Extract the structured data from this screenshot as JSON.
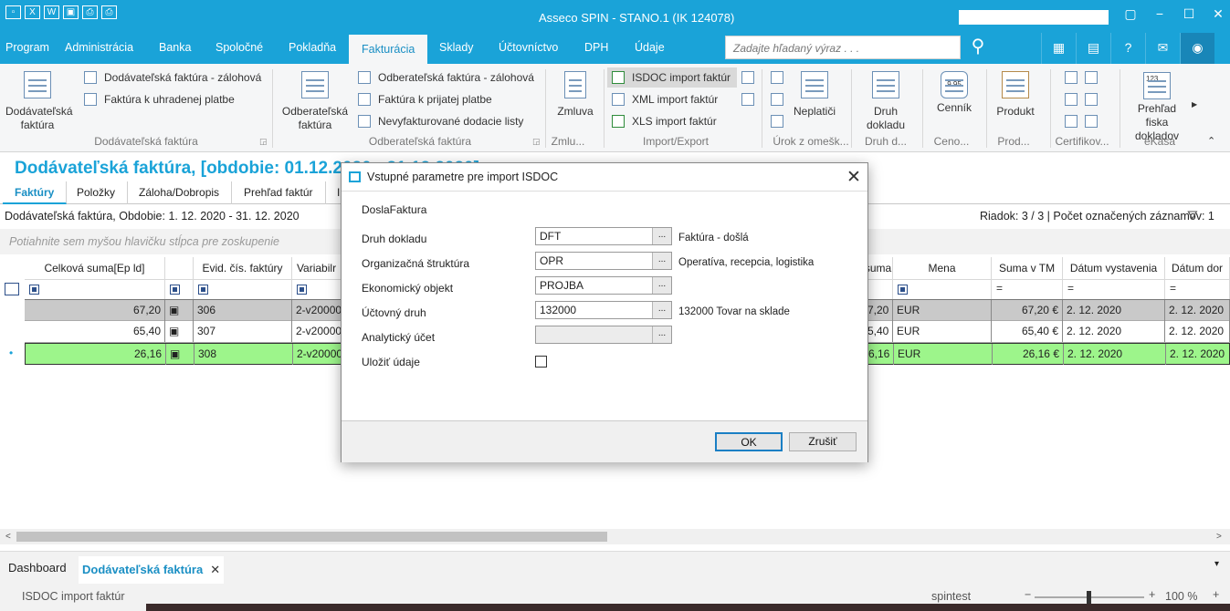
{
  "app": {
    "title": "Asseco SPIN    -    STANO.1 (IK 124078)"
  },
  "menu": {
    "items": [
      "Program",
      "Administrácia",
      "Banka",
      "Spoločné",
      "Pokladňa",
      "Fakturácia",
      "Sklady",
      "Účtovníctvo",
      "DPH",
      "Údaje"
    ],
    "active": "Fakturácia",
    "search_placeholder": "Zadajte hľadaný výraz . . ."
  },
  "ribbon": {
    "dodavatelska": {
      "big_label": "Dodávateľská faktúra",
      "small1": "Dodávateľská faktúra - zálohová",
      "small2": "Faktúra k uhradenej platbe",
      "group": "Dodávateľská faktúra"
    },
    "odberatelska": {
      "big_label": "Odberateľská faktúra",
      "small1": "Odberateľská faktúra - zálohová",
      "small2": "Faktúra k prijatej platbe",
      "small3": "Nevyfakturované dodacie listy",
      "group": "Odberateľská faktúra"
    },
    "zmluva": {
      "label": "Zmluva",
      "group": "Zmlu..."
    },
    "import_export": {
      "isdoc": "ISDOC import faktúr",
      "xml": "XML import faktúr",
      "xls": "XLS import faktúr",
      "group": "Import/Export"
    },
    "neplatici": {
      "label": "Neplatiči",
      "group": "Úrok z omešk..."
    },
    "druh_dokladu": {
      "label": "Druh dokladu",
      "group": "Druh d..."
    },
    "cennik": {
      "label": "Cenník",
      "group": "Ceno...",
      "price_tag": "9.95"
    },
    "produkt": {
      "label": "Produkt",
      "group": "Prod..."
    },
    "certifikovat": {
      "group": "Certifikov..."
    },
    "ekasa": {
      "label": "Prehľad fiska dokladov",
      "group": "eKasa",
      "badge": "123"
    }
  },
  "document": {
    "title": "Dodávateľská faktúra, [obdobie: 01.12.2020 - 31.12.2020]",
    "tabs": [
      "Faktúry",
      "Položky",
      "Záloha/Dobropis",
      "Prehľad faktúr",
      "Ir"
    ],
    "active_tab": "Faktúry",
    "period": "Dodávateľská faktúra, Obdobie: 1. 12. 2020 - 31. 12. 2020",
    "row_info": "Riadok: 3 / 3 | Počet označených záznamov: 1",
    "group_hint": "Potiahnite sem myšou hlavičku stĺpca pre zoskupenie"
  },
  "grid": {
    "headers": {
      "celkova_suma": "Celková suma[Ep ld]",
      "evid": "Evid. čís. faktúry",
      "variabilny": "Variabilr",
      "suma": "suma",
      "mena": "Mena",
      "suma_tm": "Suma v TM",
      "datum_vystavenia": "Dátum vystavenia",
      "datum_dor": "Dátum dor"
    },
    "rows": [
      {
        "celkova": "67,20",
        "evid": "306",
        "var": "2-v20000",
        "suma": "7,20",
        "mena": "EUR",
        "suma_tm": "67,20 €",
        "vyst": "2. 12. 2020",
        "dor": "2. 12. 2020"
      },
      {
        "celkova": "65,40",
        "evid": "307",
        "var": "2-v20000",
        "suma": "5,40",
        "mena": "EUR",
        "suma_tm": "65,40 €",
        "vyst": "2. 12. 2020",
        "dor": "2. 12. 2020"
      },
      {
        "celkova": "26,16",
        "evid": "308",
        "var": "2-v20000",
        "suma": "6,16",
        "mena": "EUR",
        "suma_tm": "26,16 €",
        "vyst": "2. 12. 2020",
        "dor": "2. 12. 2020"
      }
    ]
  },
  "dialog": {
    "title": "Vstupné parametre pre import ISDOC",
    "section": "DoslaFaktura",
    "fields": {
      "druh_dokladu": {
        "label": "Druh dokladu",
        "value": "DFT",
        "desc": "Faktúra - došlá"
      },
      "org_struktura": {
        "label": "Organizačná štruktúra",
        "value": "OPR",
        "desc": "Operatíva, recepcia, logistika"
      },
      "ekon_objekt": {
        "label": "Ekonomický objekt",
        "value": "PROJBA",
        "desc": ""
      },
      "uctovny_druh": {
        "label": "Účtovný druh",
        "value": "132000",
        "desc": "132000 Tovar na sklade"
      },
      "analyticky_ucet": {
        "label": "Analytický účet",
        "value": "",
        "desc": ""
      },
      "ulozit": {
        "label": "Uložiť údaje"
      }
    },
    "browse_label": "...",
    "ok_label": "OK",
    "cancel_label": "Zrušiť"
  },
  "bottom_tabs": {
    "dashboard": "Dashboard",
    "active": "Dodávateľská faktúra",
    "close": "✕"
  },
  "statusbar": {
    "left": "ISDOC import faktúr",
    "user": "spintest",
    "zoom": "100 %",
    "zoom_minus": "−",
    "zoom_plus": "+"
  }
}
